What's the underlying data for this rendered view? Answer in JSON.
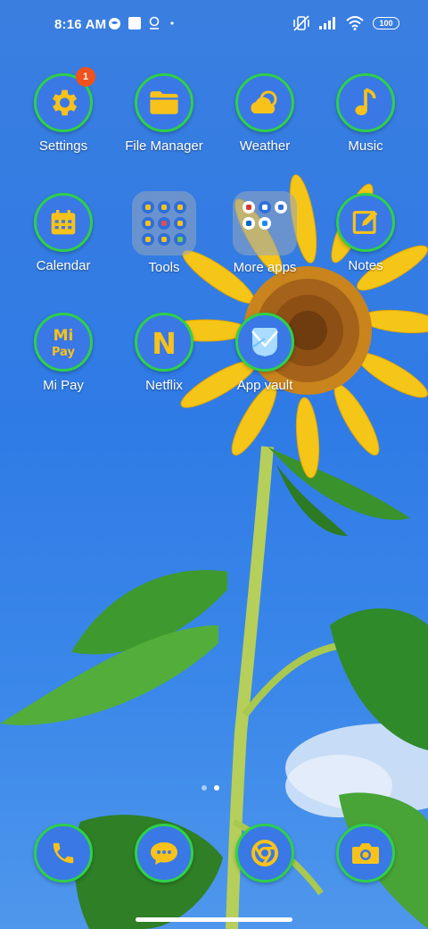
{
  "status_bar": {
    "time": "8:16 AM",
    "battery": "100",
    "icons": [
      "mask-icon",
      "square-icon",
      "location-pin-icon",
      "dot-icon",
      "vibrate-off-icon",
      "signal-icon",
      "wifi-icon",
      "battery-icon"
    ]
  },
  "home": {
    "apps": [
      {
        "label": "Settings",
        "icon": "gear-icon",
        "badge": "1"
      },
      {
        "label": "File Manager",
        "icon": "folder-icon"
      },
      {
        "label": "Weather",
        "icon": "cloud-sun-icon"
      },
      {
        "label": "Music",
        "icon": "music-note-icon"
      },
      {
        "label": "Calendar",
        "icon": "calendar-icon"
      },
      {
        "label": "Tools",
        "icon": "folder-grid-icon"
      },
      {
        "label": "More apps",
        "icon": "folder-grid-icon"
      },
      {
        "label": "Notes",
        "icon": "note-pencil-icon"
      },
      {
        "label": "Mi Pay",
        "icon": "mipay-icon",
        "logo_text": "Mi\nPay"
      },
      {
        "label": "Netflix",
        "icon": "netflix-icon",
        "logo_text": "N"
      },
      {
        "label": "App vault",
        "icon": "app-vault-icon"
      }
    ]
  },
  "page_indicator": {
    "pages": 2,
    "active": 2
  },
  "dock": {
    "apps": [
      {
        "icon": "phone-icon"
      },
      {
        "icon": "messages-icon"
      },
      {
        "icon": "chrome-icon"
      },
      {
        "icon": "camera-icon"
      }
    ]
  },
  "colors": {
    "icon_fill": "#3a78e6",
    "ring": "#2fd04a",
    "glyph": "#f8c21a",
    "badge": "#f2511b"
  }
}
